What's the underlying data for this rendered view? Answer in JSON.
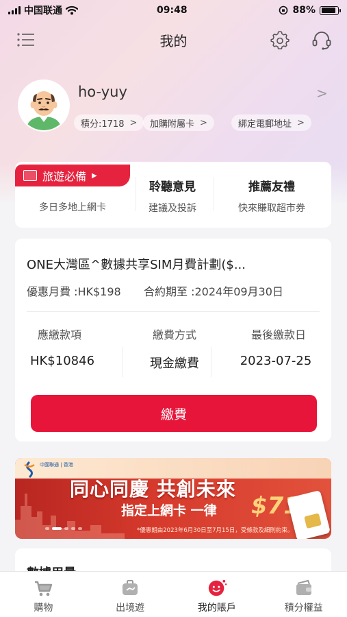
{
  "status_bar": {
    "carrier": "中国联通",
    "time": "09:48",
    "battery_pct": "88%",
    "battery_level": 0.88
  },
  "nav": {
    "title": "我的",
    "menu_icon": "menu-icon",
    "settings_icon": "gear-icon",
    "support_icon": "headset-icon"
  },
  "profile": {
    "username": "ho-yuy",
    "arrow": ">",
    "chips": [
      {
        "label": "積分:1718",
        "arrow": ">"
      },
      {
        "label": "加購附屬卡",
        "arrow": ">"
      },
      {
        "label": "綁定電郵地址",
        "arrow": ">"
      }
    ]
  },
  "services": {
    "travel_tag": "旅遊必備",
    "items": [
      {
        "title": "",
        "subtitle": "多日多地上網卡"
      },
      {
        "title": "聆聽意見",
        "subtitle": "建議及投訴"
      },
      {
        "title": "推薦友禮",
        "subtitle": "快來賺取超市券"
      }
    ]
  },
  "plan": {
    "name": "ONE大灣區^數據共享SIM月費計劃($...",
    "monthly_fee": "優惠月費 :HK$198",
    "contract_end": "合約期至 :2024年09月30日",
    "bill": {
      "headers": [
        "應繳款項",
        "繳費方式",
        "最後繳款日"
      ],
      "values": [
        "HK$10846",
        "現金繳費",
        "2023-07-25"
      ]
    },
    "pay_button": "繳費"
  },
  "banner": {
    "brand": "中國聯通 | 香港",
    "headline": "同心同慶 共創未來",
    "subline": "指定上網卡 一律",
    "price": "$71",
    "note": "*優惠期由2023年6月30日至7月15日，受條款及細則約束。",
    "slide_count": 5,
    "active_slide": 1
  },
  "data_usage": {
    "title": "數據用量"
  },
  "tabbar": {
    "active": 2,
    "tabs": [
      {
        "label": "購物",
        "icon": "cart-icon"
      },
      {
        "label": "出境遊",
        "icon": "suitcase-icon"
      },
      {
        "label": "我的賬戶",
        "icon": "account-smile-icon"
      },
      {
        "label": "積分權益",
        "icon": "wallet-icon"
      }
    ]
  },
  "colors": {
    "accent_red": "#e8153b",
    "tab_active": "#e6233f",
    "tab_inactive": "#9a9a9a"
  }
}
